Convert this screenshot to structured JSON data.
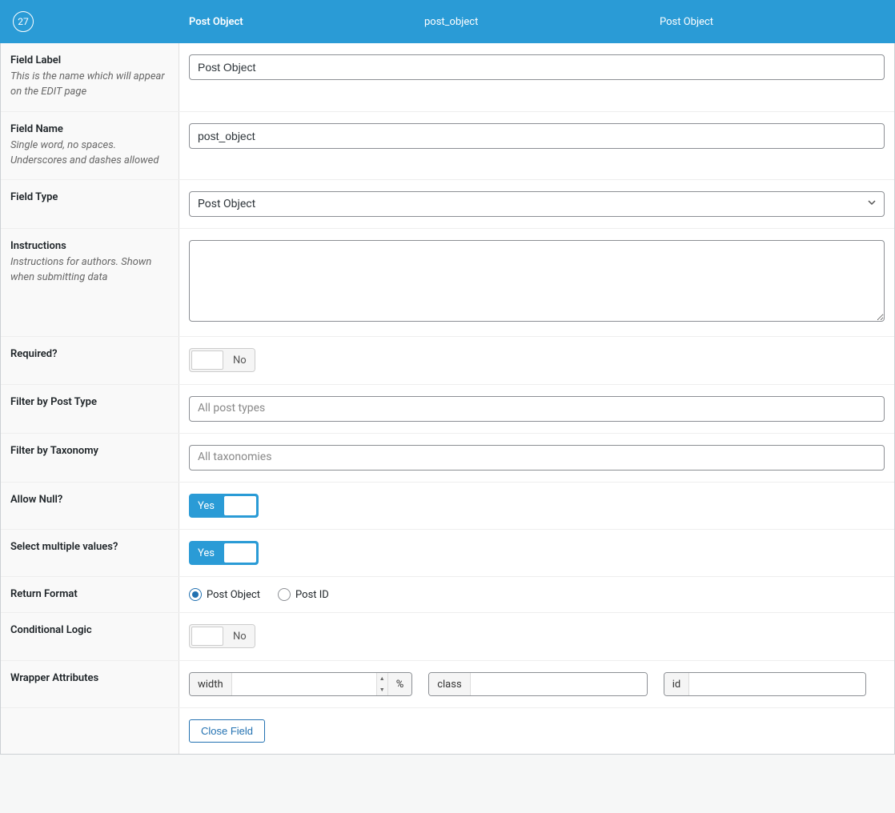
{
  "header": {
    "order": "27",
    "label": "Post Object",
    "name": "post_object",
    "type": "Post Object"
  },
  "rows": {
    "field_label": {
      "label": "Field Label",
      "desc": "This is the name which will appear on the EDIT page",
      "value": "Post Object"
    },
    "field_name": {
      "label": "Field Name",
      "desc": "Single word, no spaces. Underscores and dashes allowed",
      "value": "post_object"
    },
    "field_type": {
      "label": "Field Type",
      "value": "Post Object"
    },
    "instructions": {
      "label": "Instructions",
      "desc": "Instructions for authors. Shown when submitting data",
      "value": ""
    },
    "required": {
      "label": "Required?",
      "on": false,
      "text": "No"
    },
    "filter_post_type": {
      "label": "Filter by Post Type",
      "placeholder": "All post types"
    },
    "filter_taxonomy": {
      "label": "Filter by Taxonomy",
      "placeholder": "All taxonomies"
    },
    "allow_null": {
      "label": "Allow Null?",
      "on": true,
      "text": "Yes"
    },
    "multiple": {
      "label": "Select multiple values?",
      "on": true,
      "text": "Yes"
    },
    "return_format": {
      "label": "Return Format",
      "options": [
        {
          "label": "Post Object",
          "checked": true
        },
        {
          "label": "Post ID",
          "checked": false
        }
      ]
    },
    "conditional": {
      "label": "Conditional Logic",
      "on": false,
      "text": "No"
    },
    "wrapper": {
      "label": "Wrapper Attributes",
      "width_label": "width",
      "width_unit": "%",
      "class_label": "class",
      "id_label": "id"
    },
    "close": {
      "button": "Close Field"
    }
  }
}
